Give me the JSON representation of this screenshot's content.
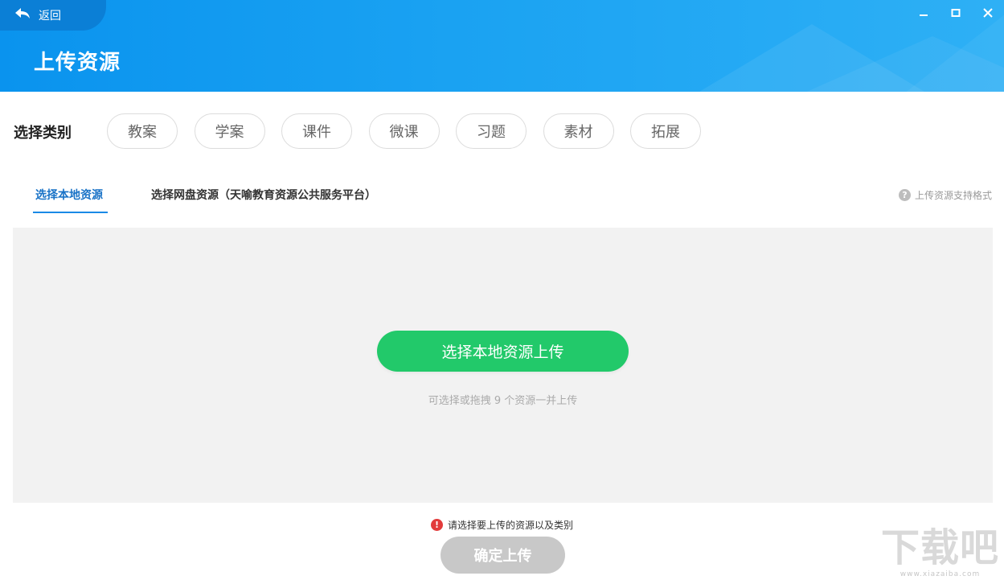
{
  "header": {
    "back_label": "返回",
    "title": "上传资源",
    "back_icon": "back-arrow-icon",
    "controls": [
      "minimize-icon",
      "maximize-icon",
      "close-icon"
    ],
    "color": "#0a93ee"
  },
  "category": {
    "label": "选择类别",
    "items": [
      {
        "label": "教案"
      },
      {
        "label": "学案"
      },
      {
        "label": "课件"
      },
      {
        "label": "微课"
      },
      {
        "label": "习题"
      },
      {
        "label": "素材"
      },
      {
        "label": "拓展"
      }
    ]
  },
  "tabs": {
    "local": "选择本地资源",
    "cloud": "选择网盘资源（天喻教育资源公共服务平台）",
    "active": "local",
    "format_help": "上传资源支持格式",
    "accent": "#1a73c7"
  },
  "drop_zone": {
    "button_label": "选择本地资源上传",
    "hint": "可选择或拖拽 9 个资源一并上传",
    "button_color": "#22c96a"
  },
  "footer": {
    "warning": "请选择要上传的资源以及类别",
    "confirm_label": "确定上传",
    "warning_color": "#e23b3b"
  },
  "watermark": {
    "mark": "下载吧",
    "url": "www.xiazaiba.com"
  }
}
